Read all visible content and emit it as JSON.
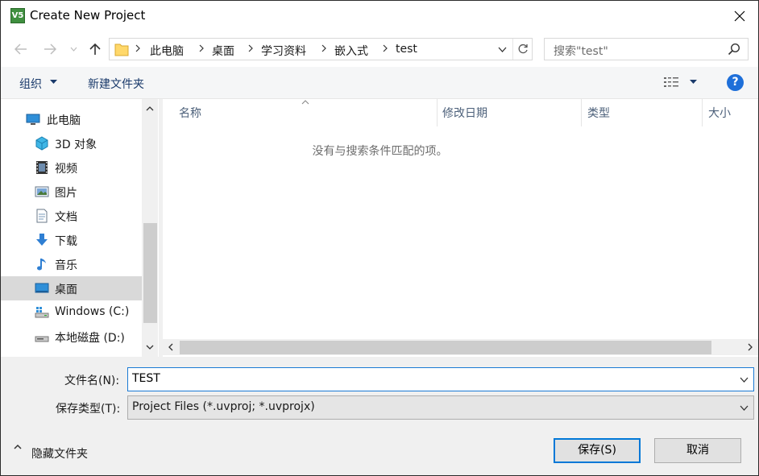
{
  "window": {
    "title": "Create New Project",
    "app_icon_text": "V5"
  },
  "address": {
    "crumbs": [
      "此电脑",
      "桌面",
      "学习资料",
      "嵌入式",
      "test"
    ]
  },
  "search": {
    "placeholder": "搜索\"test\""
  },
  "toolbar": {
    "organize_label": "组织",
    "new_folder_label": "新建文件夹",
    "help_label": "?"
  },
  "nav": {
    "items": [
      {
        "label": "此电脑",
        "icon": "computer-icon"
      },
      {
        "label": "3D 对象",
        "icon": "3d-objects-icon"
      },
      {
        "label": "视频",
        "icon": "video-icon"
      },
      {
        "label": "图片",
        "icon": "pictures-icon"
      },
      {
        "label": "文档",
        "icon": "documents-icon"
      },
      {
        "label": "下载",
        "icon": "download-icon"
      },
      {
        "label": "音乐",
        "icon": "music-icon"
      },
      {
        "label": "桌面",
        "icon": "desktop-icon",
        "selected": true
      },
      {
        "label": "Windows (C:)",
        "icon": "windows-drive-icon"
      },
      {
        "label": "本地磁盘 (D:)",
        "icon": "local-disk-icon"
      }
    ]
  },
  "files": {
    "columns": [
      "名称",
      "修改日期",
      "类型",
      "大小"
    ],
    "empty_message": "没有与搜索条件匹配的项。"
  },
  "form": {
    "filename_label": "文件名(N):",
    "filename_value": "TEST",
    "filetype_label": "保存类型(T):",
    "filetype_value": "Project Files (*.uvproj; *.uvprojx)"
  },
  "footer": {
    "hide_folders_label": "隐藏文件夹",
    "save_label": "保存(S)",
    "cancel_label": "取消"
  },
  "colors": {
    "accent": "#0078d7",
    "selected_bg": "#d9d9d9",
    "link_text": "#1a3a6b"
  }
}
